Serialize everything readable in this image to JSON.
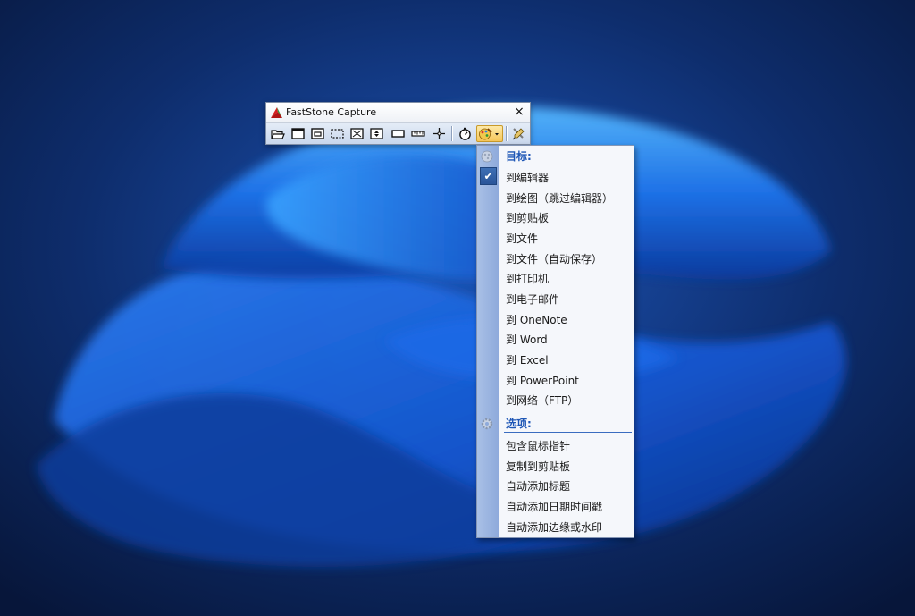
{
  "window": {
    "title": "FastStone Capture",
    "close_glyph": "×"
  },
  "toolbar": {
    "buttons": [
      {
        "name": "open-file-icon"
      },
      {
        "name": "capture-window-icon"
      },
      {
        "name": "capture-object-icon"
      },
      {
        "name": "capture-rectangle-icon"
      },
      {
        "name": "capture-fullscreen-icon"
      },
      {
        "name": "capture-scrolling-icon"
      },
      {
        "name": "capture-fixed-region-icon"
      },
      {
        "name": "screen-ruler-icon"
      },
      {
        "name": "crosshair-icon"
      },
      {
        "name": "delay-timer-icon"
      },
      {
        "name": "output-destination-icon"
      },
      {
        "name": "settings-icon"
      }
    ]
  },
  "menu": {
    "target_header": "目标:",
    "target_items": [
      "到编辑器",
      "到绘图（跳过编辑器）",
      "到剪贴板",
      "到文件",
      "到文件（自动保存）",
      "到打印机",
      "到电子邮件",
      "到 OneNote",
      "到 Word",
      "到 Excel",
      "到 PowerPoint",
      "到网络（FTP）"
    ],
    "checked_item": "到编辑器",
    "check_glyph": "✔",
    "options_header": "选项:",
    "option_items": [
      "包含鼠标指针",
      "复制到剪贴板",
      "自动添加标题",
      "自动添加日期时间戳",
      "自动添加边缘或水印"
    ]
  },
  "colors": {
    "menu_header": "#1f57b6",
    "menu_gutter": "#8eaadb",
    "toolbar_bg": "#c9d7ec",
    "desktop_bg": "#0b1d45"
  }
}
